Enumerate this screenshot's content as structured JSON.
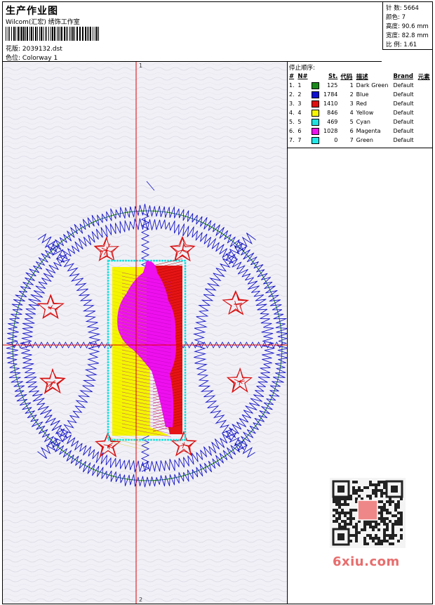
{
  "header": {
    "title": "生产作业图",
    "company": "Wilcom(汇宏) 绣饰工作室",
    "design_label": "花版:",
    "design_value": "2039132.dst",
    "colorway_label": "色位:",
    "colorway_value": "Colorway 1"
  },
  "stats": {
    "stitches_label": "针 数:",
    "stitches": "5664",
    "colors_label": "颜色:",
    "colors": "7",
    "height_label": "高度:",
    "height": "90.6 mm",
    "width_label": "宽度:",
    "width": "82.8 mm",
    "ratio_label": "比 例:",
    "ratio": "1.61"
  },
  "canvas": {
    "top_marker": "1",
    "bottom_marker": "2"
  },
  "stop_sequence": {
    "title": "停止顺序:",
    "headers": [
      "#",
      "N#",
      "",
      "St.",
      "代码",
      "描述",
      "Brand",
      "元素"
    ],
    "rows": [
      {
        "idx": "1.",
        "n": "1",
        "color": "#1a8a1a",
        "st": "125",
        "code": "1",
        "desc": "Dark Green",
        "brand": "Default"
      },
      {
        "idx": "2.",
        "n": "2",
        "color": "#1010d0",
        "st": "1784",
        "code": "2",
        "desc": "Blue",
        "brand": "Default"
      },
      {
        "idx": "3.",
        "n": "3",
        "color": "#e01010",
        "st": "1410",
        "code": "3",
        "desc": "Red",
        "brand": "Default"
      },
      {
        "idx": "4.",
        "n": "4",
        "color": "#f5f500",
        "st": "846",
        "code": "4",
        "desc": "Yellow",
        "brand": "Default"
      },
      {
        "idx": "5.",
        "n": "5",
        "color": "#20e0e0",
        "st": "469",
        "code": "5",
        "desc": "Cyan",
        "brand": "Default"
      },
      {
        "idx": "6.",
        "n": "6",
        "color": "#ee10ee",
        "st": "1028",
        "code": "6",
        "desc": "Magenta",
        "brand": "Default"
      },
      {
        "idx": "7.",
        "n": "7",
        "color": "#20e8e8",
        "st": "0",
        "code": "7",
        "desc": "Green",
        "brand": "Default"
      }
    ]
  },
  "watermark": {
    "site": "6xiu.com",
    "qr_label": "QR code"
  }
}
